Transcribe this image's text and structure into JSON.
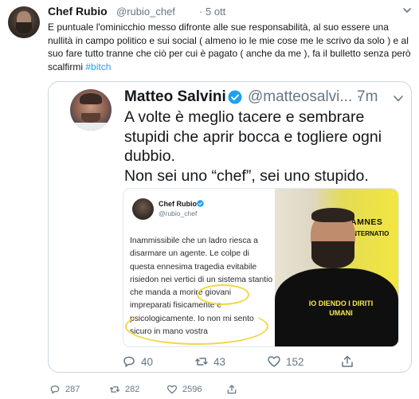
{
  "tweet": {
    "author_name": "Chef Rubio",
    "author_handle": "@rubio_chef",
    "separator": "·",
    "time": "5 ott",
    "text_main": "E puntuale l'ominicchio messo difronte alle sue responsabilità, al suo essere una nullità in campo politico e sui social ( almeno io le mie cose me le scrivo da solo ) e al suo fare tutto tranne che ciò per cui è pagato ( anche da me ), fa il bulletto senza però scalfirmi ",
    "hashtag": "#bitch",
    "actions": {
      "replies": "287",
      "retweets": "282",
      "likes": "2596"
    }
  },
  "quoted": {
    "author_name": "Matteo Salvini",
    "author_handle": "@matteosalvi...",
    "separator": "·",
    "time": "7m",
    "text_line1": "A volte è meglio tacere e sembrare stupidi che aprir bocca e togliere ogni dubbio.",
    "text_line2": "Non sei uno “chef”, sei uno stupido.",
    "actions": {
      "replies": "40",
      "retweets": "43",
      "likes": "152"
    },
    "image": {
      "inner_name": "Chef Rubio",
      "inner_handle": "@rubio_chef",
      "inner_text": "Inammissibile che un ladro riesca a disarmare un agente. Le colpe di questa ennesima tragedia evitabile risiedon nei vertici di un sistema stantio che manda a morire giovani impreparati fisicamente e psicologicamente. Io non mi sento sicuro in mano vostra",
      "banner_text_1": "AMNES",
      "banner_text_2": "INTERNATIO",
      "shirt_text": "IO DIENDO I DIRITI UMANI"
    }
  },
  "colors": {
    "accent": "#1da1f2",
    "muted": "#657786",
    "border": "#ccd6dd",
    "highlight": "#f2d645"
  }
}
